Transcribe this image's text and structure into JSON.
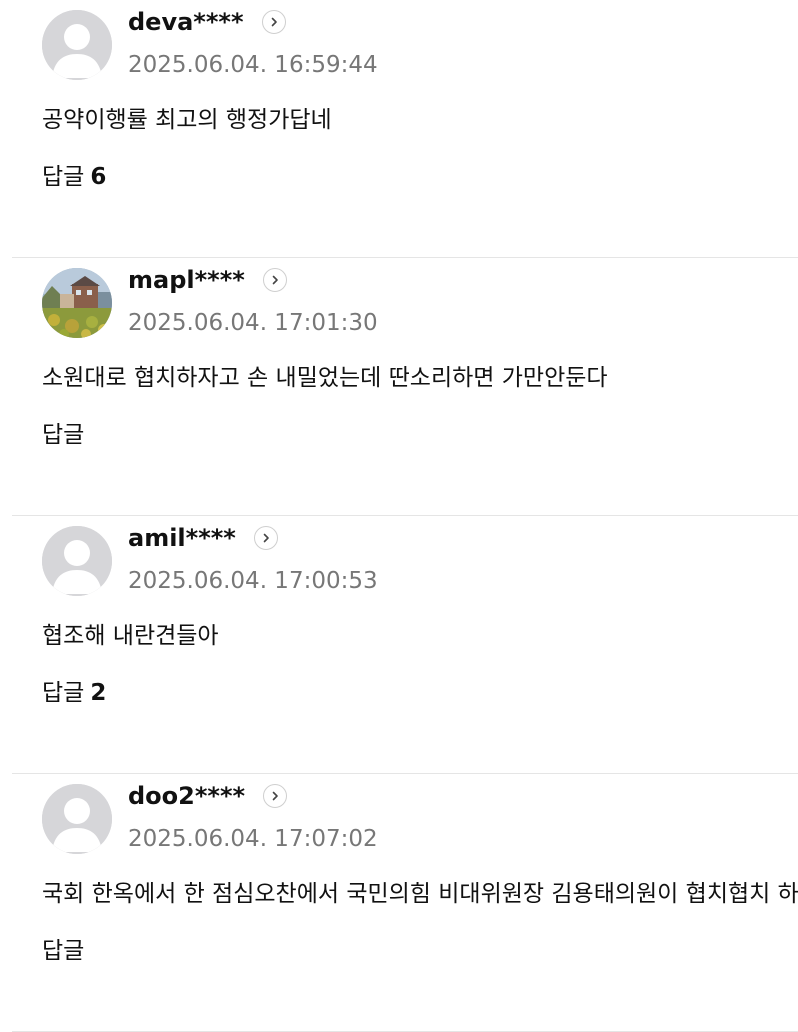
{
  "comments": [
    {
      "username": "deva****",
      "timestamp": "2025.06.04. 16:59:44",
      "text": "공약이행률 최고의 행정가답네",
      "reply_label": "답글",
      "reply_count": "6",
      "avatar": "default-avatar-icon"
    },
    {
      "username": "mapl****",
      "timestamp": "2025.06.04. 17:01:30",
      "text": "소원대로 협치하자고 손 내밀었는데 딴소리하면 가만안둔다",
      "reply_label": "답글",
      "reply_count": "",
      "avatar": "photo"
    },
    {
      "username": "amil****",
      "timestamp": "2025.06.04. 17:00:53",
      "text": "협조해 내란견들아",
      "reply_label": "답글",
      "reply_count": "2",
      "avatar": "default-avatar-icon"
    },
    {
      "username": "doo2****",
      "timestamp": "2025.06.04. 17:07:02",
      "text": "국회 한옥에서 한 점심오찬에서 국민의힘 비대위원장 김용태의원이 협치협치 하",
      "reply_label": "답글",
      "reply_count": "",
      "avatar": "default-avatar-icon"
    }
  ],
  "colors": {
    "avatar_bg": "#d6d6d9",
    "timestamp": "#777777",
    "divider": "#e5e5e5"
  }
}
